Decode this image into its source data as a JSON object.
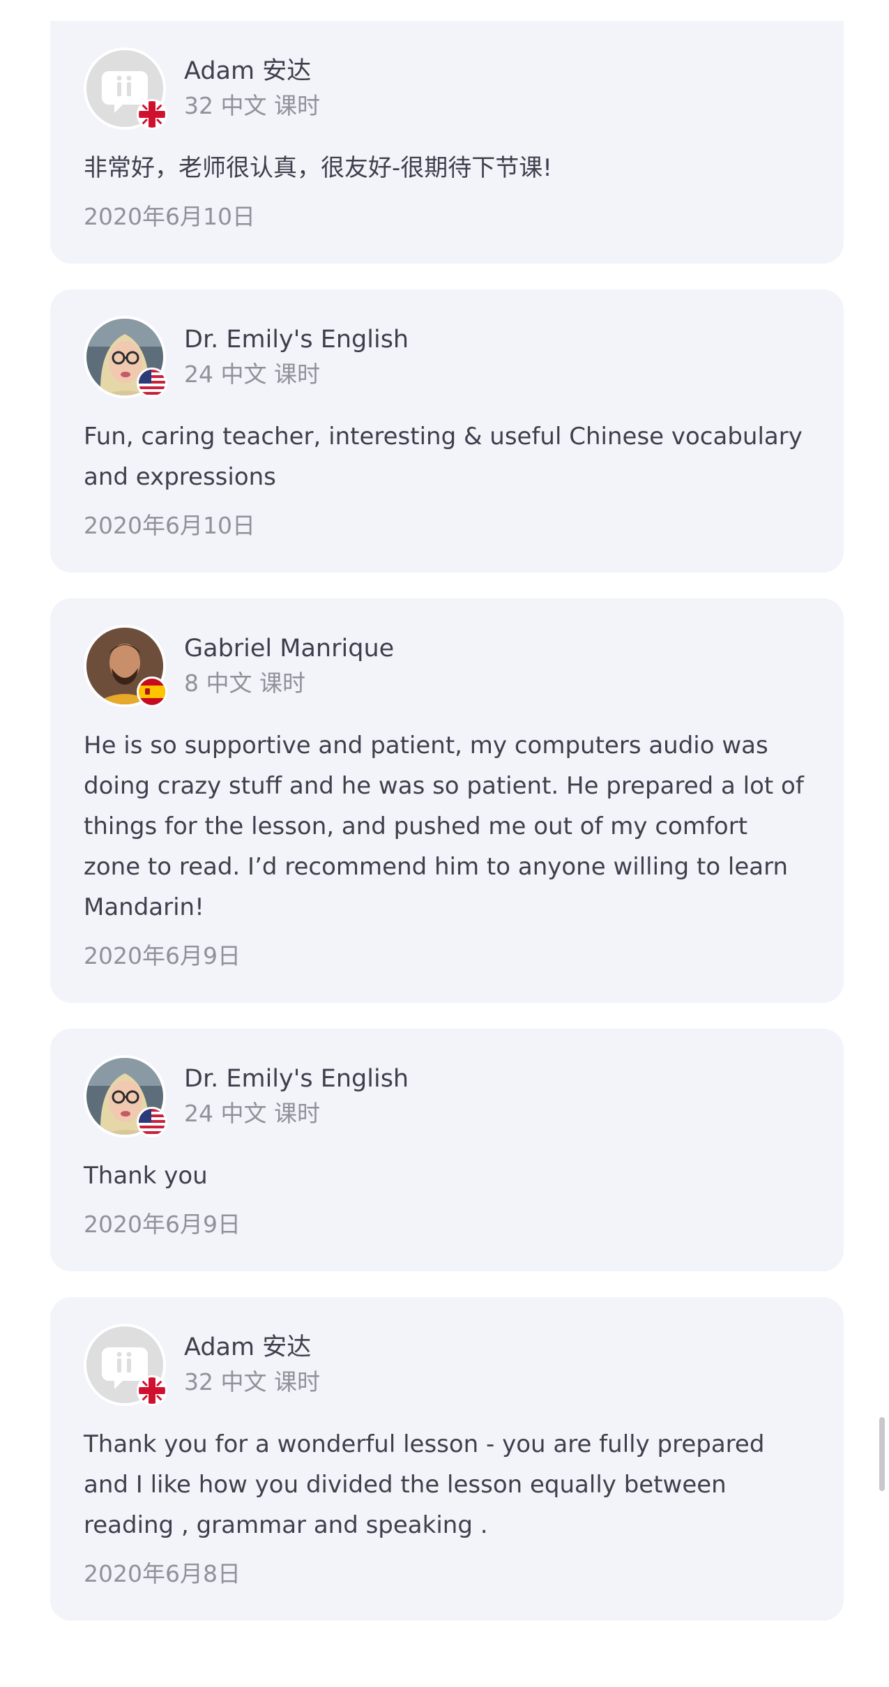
{
  "reviews": [
    {
      "name": "Adam 安达",
      "lessons": "32 中文 课时",
      "text": "非常好，老师很认真，很友好-很期待下节课!",
      "date": "2020年6月10日",
      "avatar": "default-avatar",
      "flag": "uk-flag-icon"
    },
    {
      "name": "Dr. Emily's English",
      "lessons": "24 中文 课时",
      "text": "Fun, caring teacher, interesting & useful Chinese vocabulary and expressions",
      "date": "2020年6月10日",
      "avatar": "user-photo",
      "flag": "us-flag-icon"
    },
    {
      "name": "Gabriel Manrique",
      "lessons": "8 中文 课时",
      "text": "He is so supportive and patient, my computers audio was doing crazy stuff and he was so patient. He prepared a lot of things for the lesson, and pushed me out of my comfort zone to read. I’d recommend him to anyone willing to learn Mandarin!",
      "date": "2020年6月9日",
      "avatar": "user-photo",
      "flag": "spain-flag-icon"
    },
    {
      "name": "Dr. Emily's English",
      "lessons": "24 中文 课时",
      "text": "Thank you",
      "date": "2020年6月9日",
      "avatar": "user-photo",
      "flag": "us-flag-icon"
    },
    {
      "name": "Adam 安达",
      "lessons": "32 中文 课时",
      "text": "Thank you for a wonderful lesson - you are fully prepared and I like how you divided the lesson equally between reading , grammar and speaking .",
      "date": "2020年6月8日",
      "avatar": "default-avatar",
      "flag": "uk-flag-icon"
    }
  ],
  "colors": {
    "card_bg": "#f3f4f9",
    "text_primary": "#3d3f4c",
    "text_secondary": "#8f919b"
  }
}
